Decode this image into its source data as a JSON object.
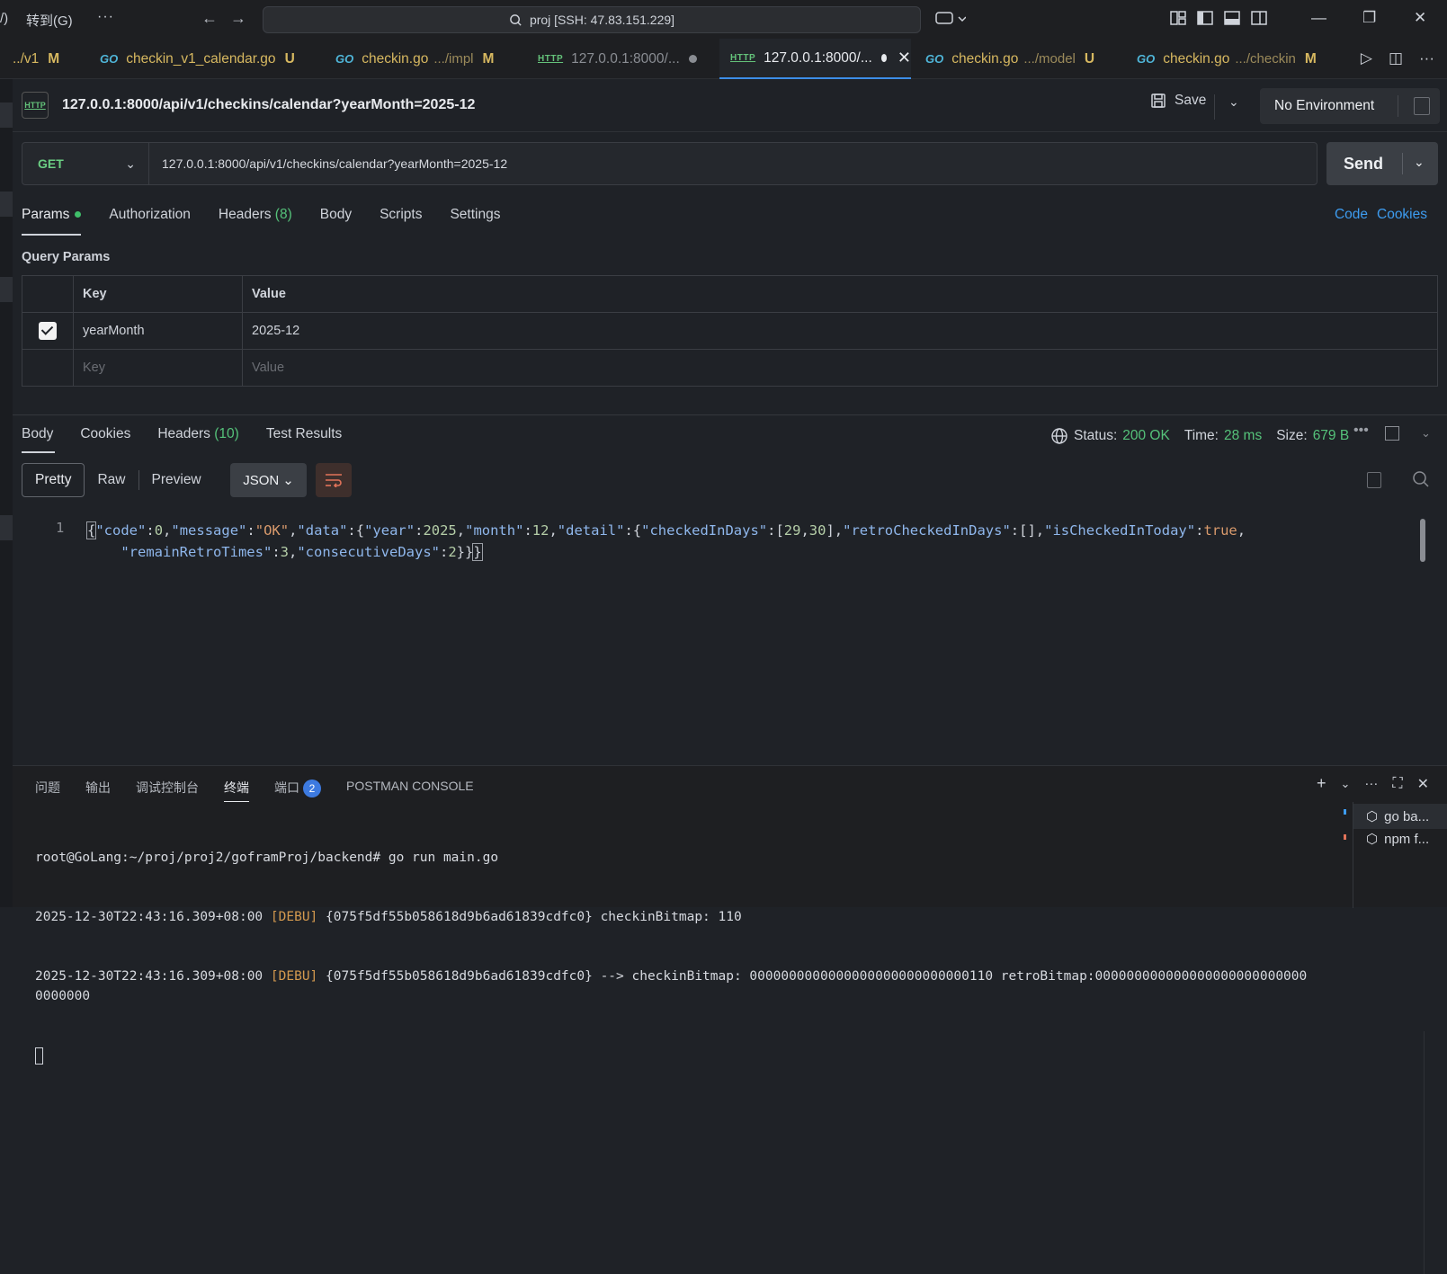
{
  "titlebar": {
    "menu_fragment": "/)",
    "goto_menu": "转到(G)",
    "more": "···",
    "search_text": "proj [SSH: 47.83.151.229]"
  },
  "tabs": [
    {
      "label": "../v1",
      "badge": "M"
    },
    {
      "label": "checkin_v1_calendar.go",
      "badge": "U"
    },
    {
      "label": "checkin.go",
      "hint": ".../impl",
      "badge": "M"
    },
    {
      "label": "127.0.0.1:8000/..."
    },
    {
      "label": "127.0.0.1:8000/..."
    },
    {
      "label": "checkin.go",
      "hint": ".../model",
      "badge": "U"
    },
    {
      "label": "checkin.go",
      "hint": ".../checkin",
      "badge": "M"
    }
  ],
  "request": {
    "title": "127.0.0.1:8000/api/v1/checkins/calendar?yearMonth=2025-12",
    "save_label": "Save",
    "environment": "No Environment",
    "method": "GET",
    "url": "127.0.0.1:8000/api/v1/checkins/calendar?yearMonth=2025-12",
    "send_label": "Send",
    "tabs": {
      "params": "Params",
      "authorization": "Authorization",
      "headers": "Headers",
      "headers_count": "(8)",
      "body": "Body",
      "scripts": "Scripts",
      "settings": "Settings"
    },
    "code_link": "Code",
    "cookies_link": "Cookies",
    "query_params_label": "Query Params",
    "table_headers": {
      "key": "Key",
      "value": "Value"
    },
    "params_rows": [
      {
        "key": "yearMonth",
        "value": "2025-12",
        "checked": true
      }
    ],
    "placeholder_key": "Key",
    "placeholder_value": "Value"
  },
  "response": {
    "tabs": {
      "body": "Body",
      "cookies": "Cookies",
      "headers": "Headers",
      "headers_count": "(10)",
      "test_results": "Test Results"
    },
    "status_label": "Status:",
    "status_value": "200 OK",
    "time_label": "Time:",
    "time_value": "28 ms",
    "size_label": "Size:",
    "size_value": "679 B",
    "more": "•••",
    "views": {
      "pretty": "Pretty",
      "raw": "Raw",
      "preview": "Preview"
    },
    "format": "JSON",
    "line_number": "1",
    "body": {
      "code": 0,
      "message": "OK",
      "year": 2025,
      "month": 12,
      "checkedInDays": [
        29,
        30
      ],
      "retroCheckedInDays": [],
      "isCheckedInToday": true,
      "remainRetroTimes": 3,
      "consecutiveDays": 2
    }
  },
  "panel": {
    "tabs": {
      "problems": "问题",
      "output": "输出",
      "debug_console": "调试控制台",
      "terminal": "终端",
      "ports": "端口",
      "ports_count": "2",
      "postman_console": "POSTMAN CONSOLE"
    },
    "terminal_lines": {
      "prompt": "root@GoLang:~/proj/proj2/goframProj/backend# go run main.go",
      "line2_prefix": "2025-12-30T22:43:16.309+08:00 ",
      "level": "[DEBU]",
      "line2_text": " {075f5df55b058618d9b6ad61839cdfc0} checkinBitmap: 110",
      "line3_prefix": "2025-12-30T22:43:16.309+08:00 ",
      "line3_text": " {075f5df55b058618d9b6ad61839cdfc0} --> checkinBitmap: 0000000000000000000000000000110 retroBitmap:0000000000000000000000000000000000"
    },
    "terminals": [
      {
        "label": "go ba..."
      },
      {
        "label": "npm f..."
      }
    ]
  },
  "colors": {
    "accent_blue": "#3d9cf0",
    "status_green": "#55c27a",
    "method_green": "#6bcf83",
    "modified_yellow": "#d7b860"
  }
}
